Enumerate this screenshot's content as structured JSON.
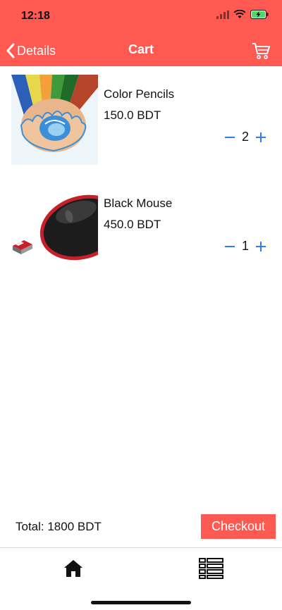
{
  "status_bar": {
    "time": "12:18"
  },
  "nav": {
    "back_label": "Details",
    "title": "Cart",
    "cart_icon": "cart-icon"
  },
  "cart": {
    "items": [
      {
        "name": "Color Pencils",
        "price": "150.0 BDT",
        "quantity": "2",
        "image": "color-pencils-image"
      },
      {
        "name": "Black Mouse",
        "price": "450.0 BDT",
        "quantity": "1",
        "image": "black-mouse-image"
      }
    ]
  },
  "summary": {
    "total": "Total: 1800 BDT",
    "checkout_label": "Checkout"
  },
  "tabbar": {
    "tabs": [
      {
        "icon": "home-icon"
      },
      {
        "icon": "list-icon"
      }
    ]
  },
  "colors": {
    "accent": "#fe5a52",
    "stepper": "#2f7cf6",
    "text": "#111111"
  }
}
